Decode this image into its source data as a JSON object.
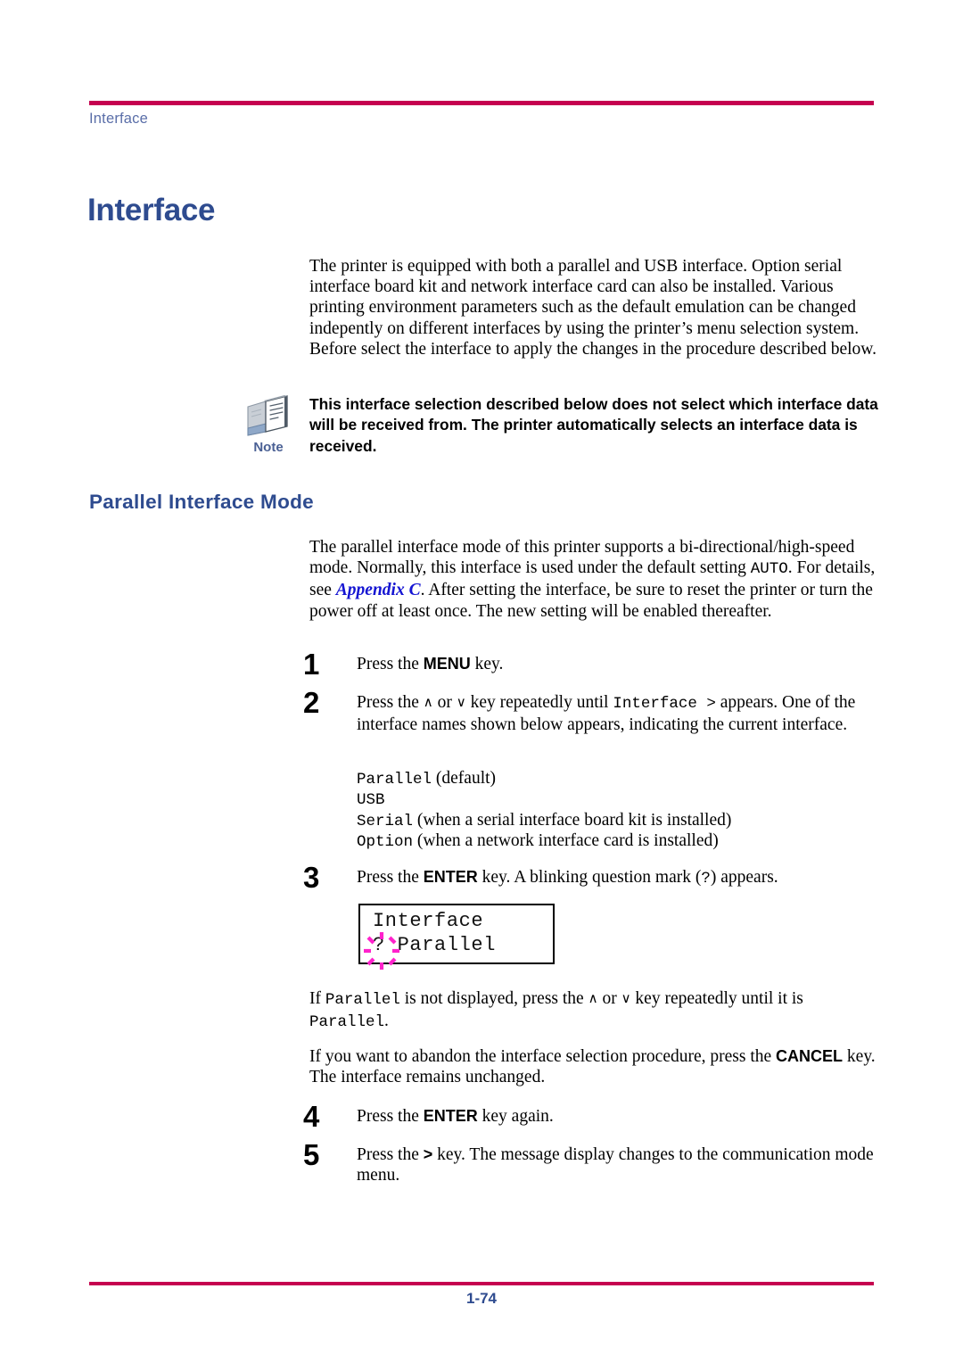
{
  "header": {
    "breadcrumb": "Interface",
    "rule_color": "#c5004f"
  },
  "chapter": {
    "title": "Interface",
    "title_color": "#2e4b8f"
  },
  "intro": {
    "text": "The printer is equipped with both a parallel and USB interface. Option serial interface board kit and network interface card can also be installed. Various printing environment parameters such as the default emulation can be changed indepently on different interfaces by using the printer’s menu selection system. Before select the interface to apply the changes in the procedure described below."
  },
  "note": {
    "icon": "note-document-icon",
    "label": "Note",
    "label_color": "#4a6094",
    "text": "This interface selection described below does not select which interface data will be received from. The printer automatically selects an interface data is received."
  },
  "section": {
    "heading": "Parallel Interface Mode",
    "para_1": "The parallel interface mode of this printer supports a bi-directional/high-speed mode. Normally, this interface is used under the default setting ",
    "para_auto": "AUTO",
    "para_2": ". For details, see ",
    "xref": "Appendix C",
    "xref_color": "#1414d2",
    "para_3": ". After setting the interface, be sure to reset the printer or turn the power off at least once. The new setting will be enabled thereafter."
  },
  "steps": {
    "s1": {
      "num": "1",
      "a": "Press the ",
      "key": "MENU",
      "b": " key."
    },
    "s2": {
      "num": "2",
      "a": "Press the ",
      "up": "∧",
      "mid": " or ",
      "down": "∨",
      "b": " key repeatedly until ",
      "mono": "Interface >",
      "c": " appears. One of the interface names shown below appears, indicating the current interface."
    },
    "s3": {
      "num": "3",
      "a": "Press the ",
      "key": "ENTER",
      "b": " key. A blinking question mark (",
      "qmark": "?",
      "c": ") appears."
    },
    "s4": {
      "num": "4",
      "a": "Press the ",
      "key": "ENTER",
      "b": " key again."
    },
    "s5": {
      "num": "5",
      "a": "Press the ",
      "key": ">",
      "b": " key. The message display changes to the communication mode menu."
    }
  },
  "interface_list": [
    {
      "name": "Parallel",
      "desc": "(default)"
    },
    {
      "name": "USB",
      "desc": ""
    },
    {
      "name": "Serial",
      "desc": "(when a serial interface board kit is installed)"
    },
    {
      "name": "Option",
      "desc": "(when a network interface card is installed)"
    }
  ],
  "lcd": {
    "line1": "Interface",
    "line2": "? Parallel",
    "blink_color": "#ff22cc"
  },
  "after_lcd": {
    "p1_a": "If ",
    "p1_mono1": "Parallel",
    "p1_b": " is not displayed, press the ",
    "p1_up": "∧",
    "p1_mid": " or ",
    "p1_down": "∨",
    "p1_c": " key repeatedly until it is ",
    "p1_mono2": "Parallel",
    "p1_d": ".",
    "p2_a": "If you want to abandon the interface selection procedure, press the ",
    "p2_key": "CANCEL",
    "p2_b": " key. The interface remains unchanged."
  },
  "footer": {
    "page_number": "1-74",
    "rule_color": "#c5004f"
  }
}
